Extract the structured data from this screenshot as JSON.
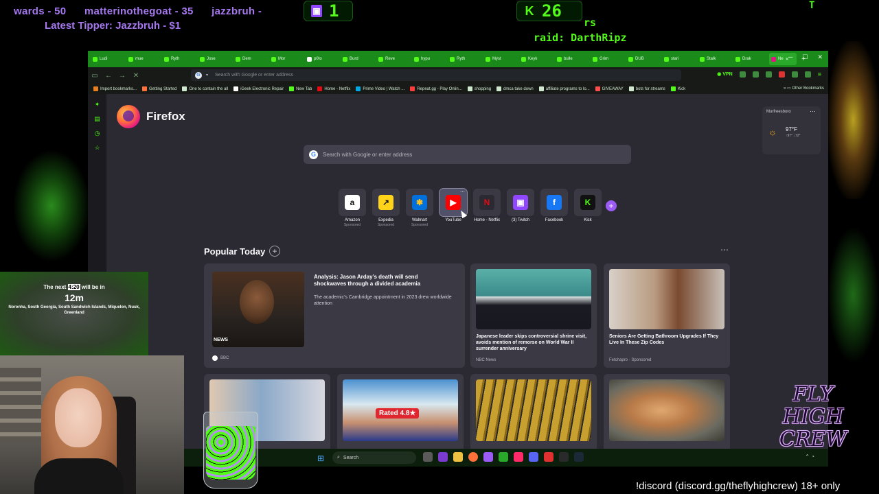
{
  "overlay": {
    "ticker": [
      "wards - 50",
      "matterinothegoat - 35",
      "jazzbruh -"
    ],
    "latest_tipper": "Latest Tipper: Jazzbruh - $1",
    "twitch_count": "1",
    "kick_count": "26",
    "kick_icon": "K",
    "rs_text": "rs",
    "raid_text": "raid: DarthRipz",
    "corner_text": "T",
    "discord_text": "!discord (discord.gg/theflyhighcrew) 18+ only",
    "logo_text": [
      "FLY",
      "HIGH",
      "CREW"
    ],
    "colors": {
      "accent_green": "#53fc18",
      "accent_purple": "#a678f0"
    }
  },
  "timer_widget": {
    "prefix": "The next",
    "highlight": "4:20",
    "suffix": "will be in",
    "remaining": "12m",
    "places": "Noronha, South Georgia, South Sandwich Islands, Miquelon, Nuuk, Greenland"
  },
  "browser": {
    "tabs": [
      {
        "label": "Ludi",
        "color": "#53fc18"
      },
      {
        "label": "mue",
        "color": "#53fc18"
      },
      {
        "label": "Ryth",
        "color": "#53fc18"
      },
      {
        "label": "Jose",
        "color": "#53fc18"
      },
      {
        "label": "Dem",
        "color": "#53fc18"
      },
      {
        "label": "Mor",
        "color": "#53fc18"
      },
      {
        "label": "p0to",
        "color": "#ffffff"
      },
      {
        "label": "Burd",
        "color": "#53fc18"
      },
      {
        "label": "Reve",
        "color": "#53fc18"
      },
      {
        "label": "hypu",
        "color": "#53fc18"
      },
      {
        "label": "Ryth",
        "color": "#53fc18"
      },
      {
        "label": "Myst",
        "color": "#53fc18"
      },
      {
        "label": "Keyk",
        "color": "#53fc18"
      },
      {
        "label": "bulle",
        "color": "#53fc18"
      },
      {
        "label": "Grim",
        "color": "#53fc18"
      },
      {
        "label": "DUB",
        "color": "#53fc18"
      },
      {
        "label": "stari",
        "color": "#53fc18"
      },
      {
        "label": "Stalk",
        "color": "#53fc18"
      },
      {
        "label": "Drak",
        "color": "#53fc18"
      },
      {
        "label": "Ne",
        "color": "#e31587",
        "active": true
      }
    ],
    "url_placeholder": "Search with Google or enter address",
    "vpn_label": "VPN",
    "bookmarks": [
      {
        "label": "Import bookmarks...",
        "color": "#e67e22"
      },
      {
        "label": "Getting Started",
        "color": "#ff7139"
      },
      {
        "label": "One to contain the all",
        "color": "#cfe8cf"
      },
      {
        "label": "iGeek Electronic Repair",
        "color": "#ffffff"
      },
      {
        "label": "New Tab",
        "color": "#53fc18"
      },
      {
        "label": "Home - Netflix",
        "color": "#e50914"
      },
      {
        "label": "Prime Video | Watch ...",
        "color": "#00a8e1"
      },
      {
        "label": "Repeat.gg - Play Onlin...",
        "color": "#ff3c3c"
      },
      {
        "label": "shopping",
        "color": "#cfe8cf"
      },
      {
        "label": "dmca take down",
        "color": "#cfe8cf"
      },
      {
        "label": "affiliate programs to lo...",
        "color": "#cfe8cf"
      },
      {
        "label": "GIVEAWAY",
        "color": "#ff4b4b"
      },
      {
        "label": "bots for streams",
        "color": "#cfe8cf"
      },
      {
        "label": "Kick",
        "color": "#53fc18"
      }
    ],
    "bookmarks_other": "Other Bookmarks"
  },
  "newtab": {
    "brand": "Firefox",
    "search_placeholder": "Search with Google or enter address",
    "weather": {
      "location": "Murfreesboro",
      "temp": "97°F",
      "hilo": "↑97° ↓72°"
    },
    "shortcuts": [
      {
        "name": "amazon",
        "label": "Amazon",
        "sponsored": "Sponsored",
        "glyph": "a",
        "bg": "#ffffff",
        "fg": "#111111"
      },
      {
        "name": "expedia",
        "label": "Expedia",
        "sponsored": "Sponsored",
        "glyph": "↗",
        "bg": "#ffd31a",
        "fg": "#1a1a1a"
      },
      {
        "name": "walmart",
        "label": "Walmart",
        "sponsored": "Sponsored",
        "glyph": "✱",
        "bg": "#0071dc",
        "fg": "#ffc220"
      },
      {
        "name": "youtube",
        "label": "YouTube",
        "sponsored": "",
        "glyph": "▶",
        "bg": "#ff0000",
        "fg": "#ffffff",
        "hover": true
      },
      {
        "name": "netflix",
        "label": "Home - Netflix",
        "sponsored": "",
        "glyph": "N",
        "bg": "#2b2a33",
        "fg": "#e50914"
      },
      {
        "name": "twitch",
        "label": "(3) Twitch",
        "sponsored": "",
        "glyph": "▣",
        "bg": "#9146ff",
        "fg": "#ffffff"
      },
      {
        "name": "facebook",
        "label": "Facebook",
        "sponsored": "",
        "glyph": "f",
        "bg": "#1877f2",
        "fg": "#ffffff"
      },
      {
        "name": "kick",
        "label": "Kick",
        "sponsored": "",
        "glyph": "K",
        "bg": "#111111",
        "fg": "#53fc18"
      }
    ],
    "popular_title": "Popular Today",
    "featured": {
      "title": "Analysis: Jason Arday’s death will send shockwaves through a divided academia",
      "desc": "The academic’s Cambridge appointment in 2023 drew worldwide attention",
      "badge": "NEWS",
      "source": "BBC"
    },
    "stories": [
      {
        "title": "Japanese leader skips controversial shrine visit, avoids mention of remorse on World War II surrender anniversary",
        "source": "NBC News"
      },
      {
        "title": "Seniors Are Getting Bathroom Upgrades If They Live In These Zip Codes",
        "source": "Fetchapro · Sponsored"
      }
    ],
    "rated_badge": "Rated 4.8★"
  },
  "taskbar": {
    "search_label": "Search"
  }
}
